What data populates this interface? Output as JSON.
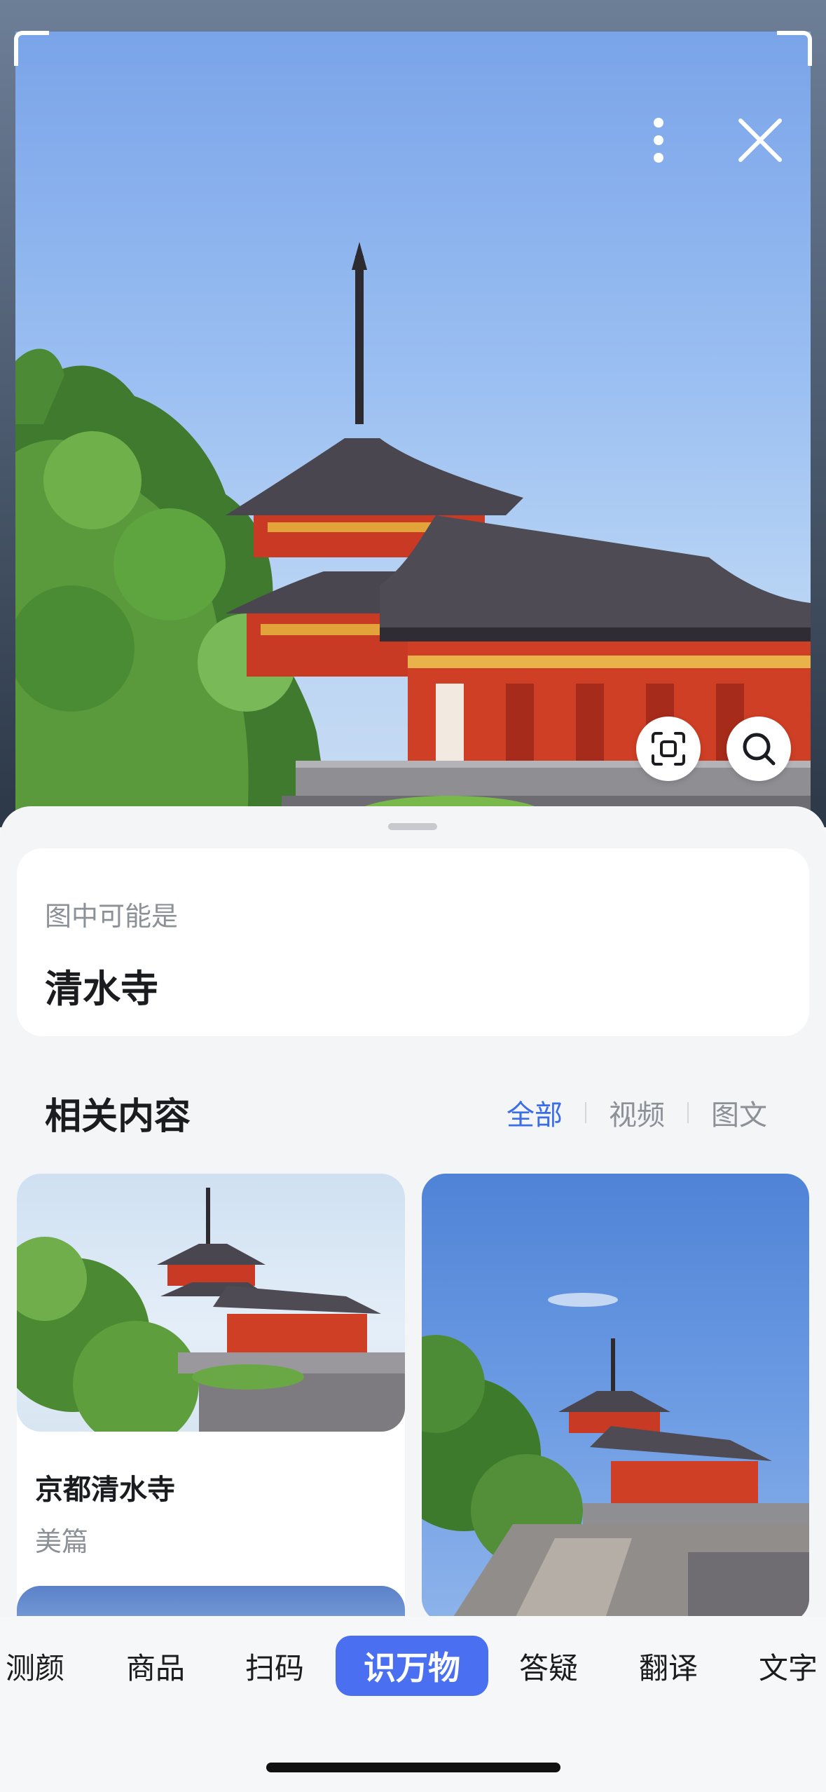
{
  "result": {
    "hint": "图中可能是",
    "title": "清水寺"
  },
  "related": {
    "title": "相关内容",
    "filters": [
      "全部",
      "视频",
      "图文"
    ],
    "active_filter": "全部",
    "cards": [
      {
        "title": "京都清水寺",
        "source": "美篇"
      }
    ]
  },
  "modes": {
    "items": [
      "测颜",
      "商品",
      "扫码",
      "识万物",
      "答疑",
      "翻译",
      "文字"
    ],
    "active": "识万物"
  },
  "colors": {
    "accent": "#4a6ff0",
    "filter_active": "#3a6ee8",
    "temple_red": "#d23a22",
    "roof_dark": "#3f3e45"
  },
  "icons": {
    "more": "more-vertical-icon",
    "close": "close-icon",
    "crop": "crop-scan-icon",
    "search": "search-icon"
  }
}
